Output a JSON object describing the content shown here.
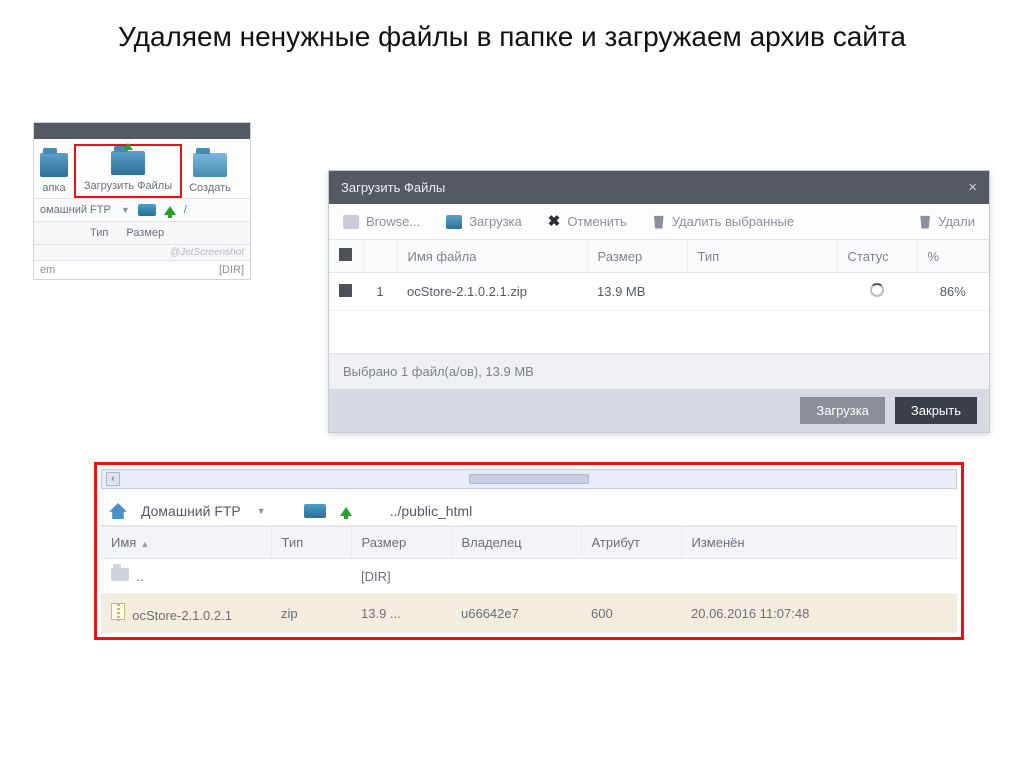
{
  "slide": {
    "title": "Удаляем ненужные файлы в папке и загружаем архив сайта"
  },
  "leftPanel": {
    "toolbarItems": [
      "апка",
      "Загрузить Файлы",
      "Создать"
    ],
    "breadcrumbLabel": "омашний FTP",
    "slash": "/",
    "cols": [
      "Тип",
      "Размер"
    ],
    "watermark": "@JetScreenshot",
    "rowName": "em",
    "rowSize": "[DIR]"
  },
  "dialog": {
    "title": "Загрузить Файлы",
    "toolbar": {
      "browse": "Browse...",
      "upload": "Загрузка",
      "cancel": "Отменить",
      "deleteSel": "Удалить выбранные",
      "delete": "Удали"
    },
    "headers": {
      "chk": "",
      "num": "",
      "name": "Имя файла",
      "size": "Размер",
      "type": "Тип",
      "status": "Статус",
      "pct": "%"
    },
    "row": {
      "num": "1",
      "name": "ocStore-2.1.0.2.1.zip",
      "size": "13.9 MB",
      "type": "",
      "pct": "86%"
    },
    "status": "Выбрано 1 файл(а/ов), 13.9 MB",
    "footer": {
      "upload": "Загрузка",
      "close": "Закрыть"
    }
  },
  "bottomPanel": {
    "breadcrumb": {
      "label": "Домашний FTP",
      "path": "../public_html"
    },
    "headers": {
      "name": "Имя",
      "type": "Тип",
      "size": "Размер",
      "owner": "Владелец",
      "attr": "Атрибут",
      "modified": "Изменён"
    },
    "rows": [
      {
        "name": "..",
        "type": "",
        "size": "[DIR]",
        "owner": "",
        "attr": "",
        "modified": ""
      },
      {
        "name": "ocStore-2.1.0.2.1",
        "type": "zip",
        "size": "13.9 ...",
        "owner": "u66642e7",
        "attr": "600",
        "modified": "20.06.2016 11:07:48"
      }
    ]
  }
}
